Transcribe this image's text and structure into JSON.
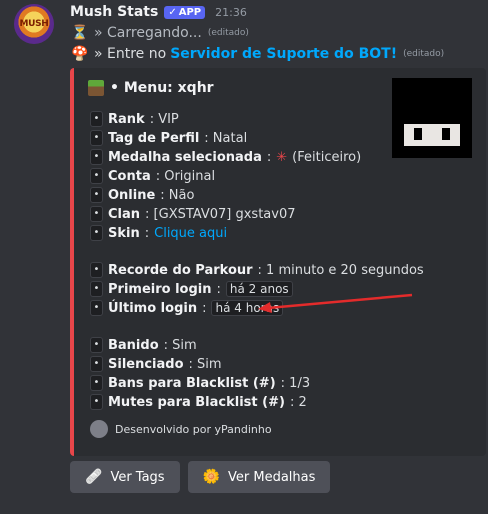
{
  "message": {
    "bot_avatar_text": "MUSH",
    "username": "Mush Stats",
    "app_badge": "APP",
    "time": "21:36",
    "lines": [
      {
        "icon": "⏳",
        "text": "» Carregando...",
        "edited": "(editado)"
      },
      {
        "icon": "🍄",
        "prefix": "» Entre no ",
        "link": "Servidor de Suporte do BOT!",
        "edited": "(editado)"
      }
    ]
  },
  "embed": {
    "accent_color": "#e8464a",
    "title_icon": "grass-block-icon",
    "title": "• Menu: xqhr",
    "fields": [
      {
        "label": "Rank",
        "value": ": VIP"
      },
      {
        "label": "Tag de Perfil",
        "value": ": Natal"
      },
      {
        "label": "Medalha selecionada",
        "emoji": "✳",
        "value": " (Feiticeiro)"
      },
      {
        "label": "Conta",
        "value": ": Original"
      },
      {
        "label": "Online",
        "value": ": Não"
      },
      {
        "label": "Clan",
        "value": ": [GXSTAV07] gxstav07"
      },
      {
        "label": "Skin",
        "link": "Clique aqui"
      },
      {
        "label": "Recorde do Parkour",
        "value": ": 1 minuto e 20 segundos"
      },
      {
        "label": "Primeiro login",
        "code": "há 2 anos"
      },
      {
        "label": "Último login",
        "code": "há 4 horas"
      },
      {
        "label": "Banido",
        "value": ": Sim"
      },
      {
        "label": "Silenciado",
        "value": ": Sim"
      },
      {
        "label": "Bans para Blacklist (#)",
        "value": ": 1/3"
      },
      {
        "label": "Mutes para Blacklist (#)",
        "value": ": 2"
      }
    ],
    "footer": "Desenvolvido por yPandinho"
  },
  "buttons": [
    {
      "emoji": "🩹",
      "label": "Ver Tags"
    },
    {
      "emoji": "🌼",
      "label": "Ver Medalhas"
    }
  ]
}
